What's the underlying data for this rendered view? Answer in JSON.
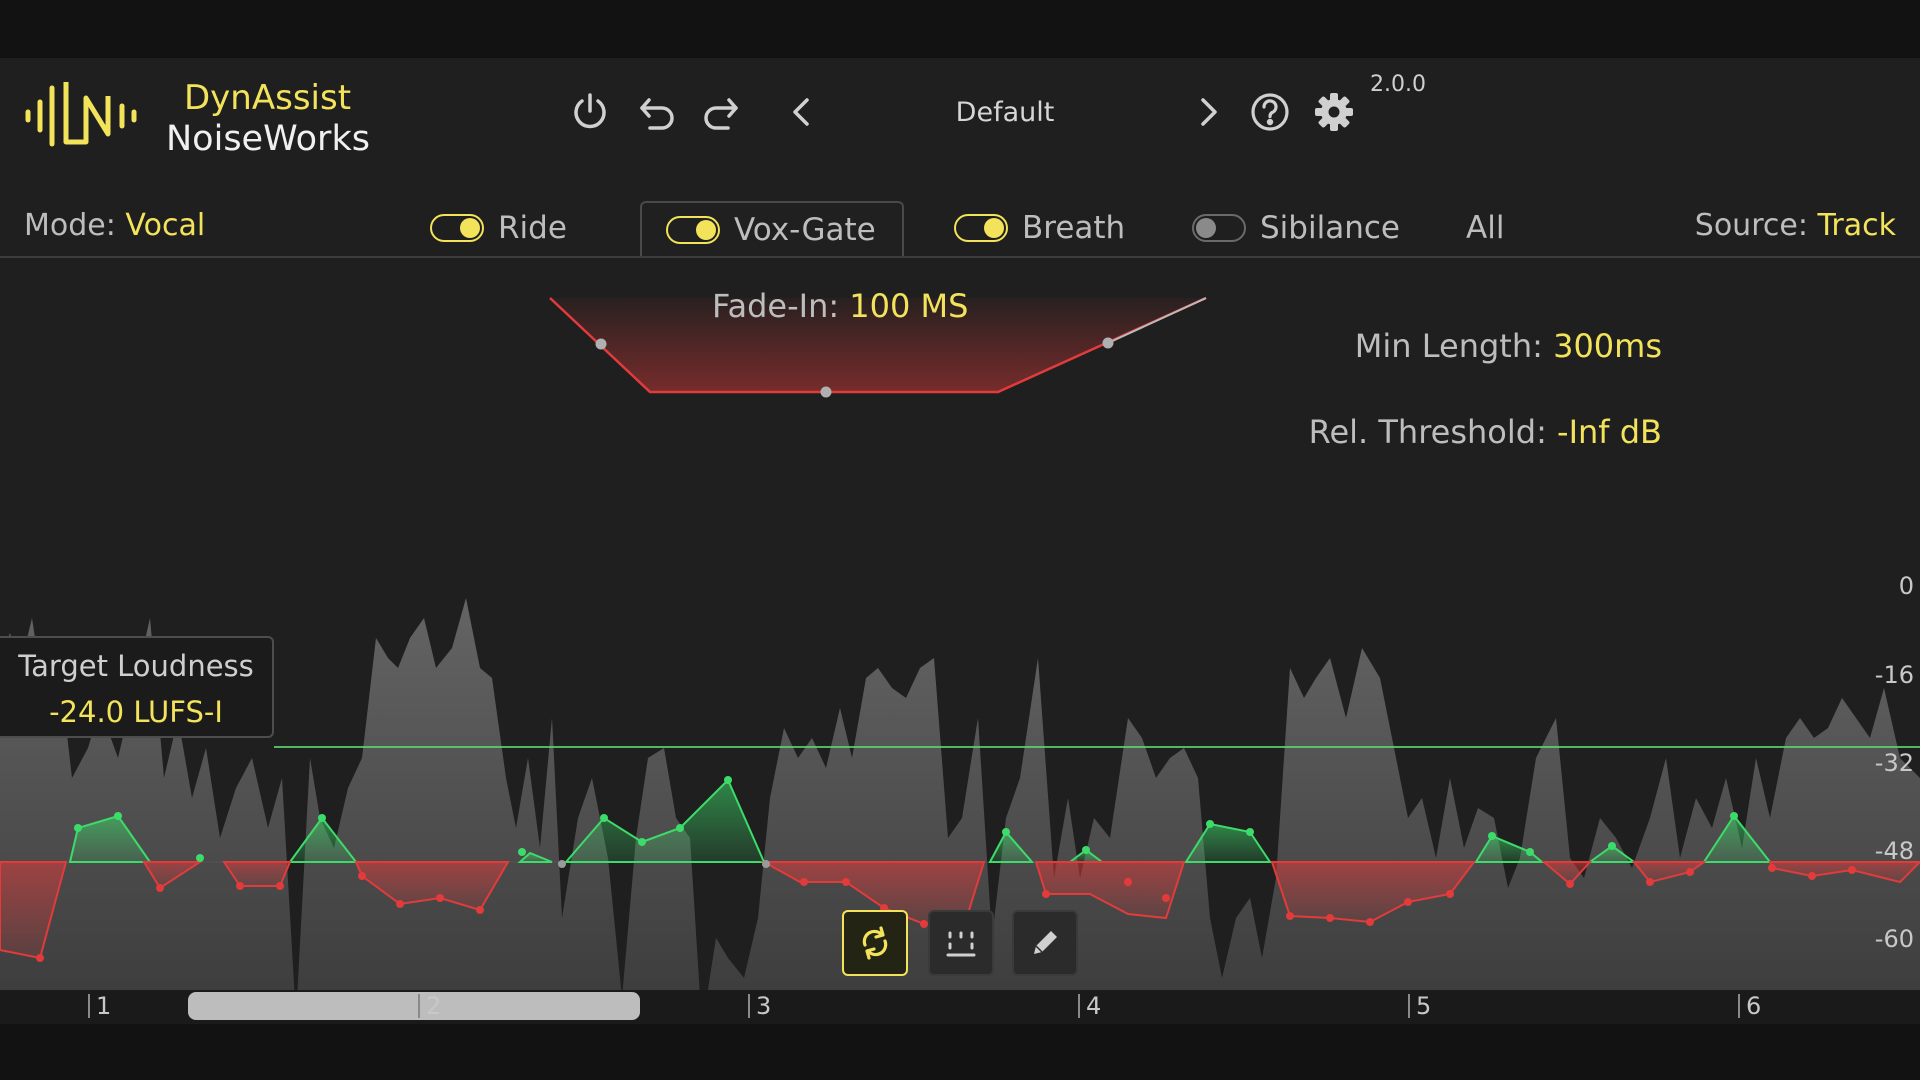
{
  "brand": {
    "line1": "DynAssist",
    "line2": "NoiseWorks"
  },
  "header": {
    "preset": "Default",
    "version": "2.0.0"
  },
  "icons": {
    "power": "power-icon",
    "undo": "undo-icon",
    "redo": "redo-icon",
    "prev": "chevron-left-icon",
    "next": "chevron-right-icon",
    "help": "help-icon",
    "settings": "gear-icon",
    "loop": "loop-icon",
    "grid": "grid-icon",
    "pencil": "pencil-icon"
  },
  "mode": {
    "label": "Mode:",
    "value": "Vocal"
  },
  "tabs": [
    {
      "label": "Ride",
      "enabled": true,
      "active": false
    },
    {
      "label": "Vox-Gate",
      "enabled": true,
      "active": true
    },
    {
      "label": "Breath",
      "enabled": true,
      "active": false
    },
    {
      "label": "Sibilance",
      "enabled": false,
      "active": false
    },
    {
      "label": "All",
      "active": false
    }
  ],
  "source": {
    "label": "Source:",
    "value": "Track"
  },
  "gate": {
    "fade_in_label": "Fade-In:",
    "fade_in_value": "100 MS",
    "min_length_label": "Min Length:",
    "min_length_value": "300ms",
    "threshold_label": "Rel. Threshold:",
    "threshold_value": "-Inf dB"
  },
  "target": {
    "label": "Target Loudness",
    "value": "-24.0 LUFS-I"
  },
  "db_scale": [
    "0",
    "-16",
    "-32",
    "-48",
    "-60"
  ],
  "timeline": {
    "markers": [
      "1",
      "2",
      "3",
      "4",
      "5",
      "6"
    ]
  },
  "colors": {
    "accent": "#f2e35a",
    "boost": "#3ddc6a",
    "cut": "#e23b3b",
    "target_line": "#59d36e"
  }
}
